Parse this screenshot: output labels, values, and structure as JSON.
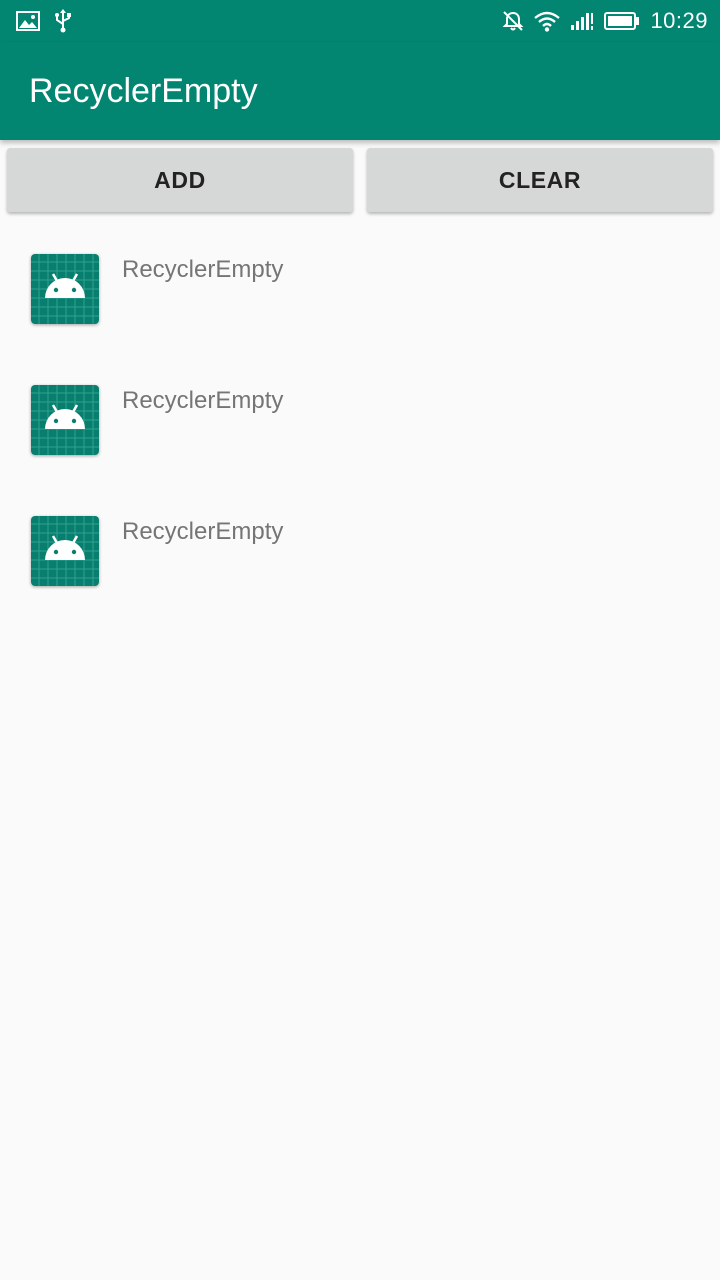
{
  "status_bar": {
    "time": "10:29",
    "left_icons": [
      "image-icon",
      "usb-icon"
    ],
    "right_icons": [
      "mute-icon",
      "wifi-icon",
      "signal-icon",
      "battery-icon"
    ],
    "color": "#028672"
  },
  "app_bar": {
    "title": "RecyclerEmpty",
    "color": "#028672"
  },
  "buttons": {
    "add_label": "ADD",
    "clear_label": "CLEAR"
  },
  "list": {
    "items": [
      {
        "icon": "android-launcher-icon",
        "label": "RecyclerEmpty"
      },
      {
        "icon": "android-launcher-icon",
        "label": "RecyclerEmpty"
      },
      {
        "icon": "android-launcher-icon",
        "label": "RecyclerEmpty"
      }
    ]
  }
}
